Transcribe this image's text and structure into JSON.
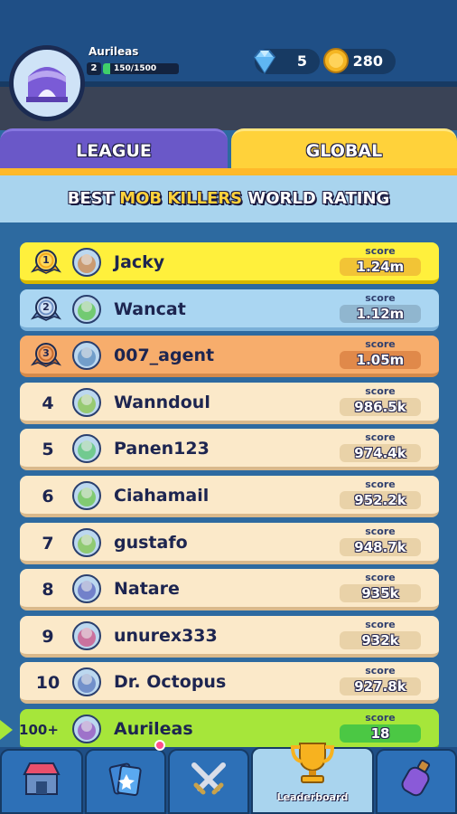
{
  "player": {
    "name": "Aurileas",
    "level": "2",
    "xp_text": "150/1500",
    "xp_fraction": 0.1
  },
  "currency": {
    "gems": "5",
    "coins": "280"
  },
  "tabs": [
    {
      "label": "LEAGUE",
      "active": false
    },
    {
      "label": "GLOBAL",
      "active": true
    }
  ],
  "banner": {
    "part1": "BEST ",
    "highlight": "MOB KILLERS",
    "part2": " WORLD RATING"
  },
  "score_label": "score",
  "rows": [
    {
      "rank": "1",
      "name": "Jacky",
      "score": "1.24m",
      "style": "gold",
      "medal": true
    },
    {
      "rank": "2",
      "name": "Wancat",
      "score": "1.12m",
      "style": "silver",
      "medal": true
    },
    {
      "rank": "3",
      "name": "007_agent",
      "score": "1.05m",
      "style": "bronze",
      "medal": true
    },
    {
      "rank": "4",
      "name": "Wanndoul",
      "score": "986.5k",
      "style": "plain",
      "medal": false
    },
    {
      "rank": "5",
      "name": "Panen123",
      "score": "974.4k",
      "style": "plain",
      "medal": false
    },
    {
      "rank": "6",
      "name": "Ciahamail",
      "score": "952.2k",
      "style": "plain",
      "medal": false
    },
    {
      "rank": "7",
      "name": "gustafo",
      "score": "948.7k",
      "style": "plain",
      "medal": false
    },
    {
      "rank": "8",
      "name": "Natare",
      "score": "935k",
      "style": "plain",
      "medal": false
    },
    {
      "rank": "9",
      "name": "unurex333",
      "score": "932k",
      "style": "plain",
      "medal": false
    },
    {
      "rank": "10",
      "name": "Dr. Octopus",
      "score": "927.8k",
      "style": "plain",
      "medal": false
    },
    {
      "rank": "100+",
      "name": "Aurileas",
      "score": "18",
      "style": "me",
      "medal": false
    }
  ],
  "nav": [
    {
      "icon": "shop-icon",
      "label": ""
    },
    {
      "icon": "cards-icon",
      "label": ""
    },
    {
      "icon": "battle-swords-icon",
      "label": ""
    },
    {
      "icon": "trophy-icon",
      "label": "Leaderboard",
      "active": true
    },
    {
      "icon": "potion-icon",
      "label": ""
    }
  ],
  "colors": {
    "gold_row": "#fff03c",
    "silver_row": "#aad6f2",
    "bronze_row": "#f7ad6c",
    "player_row": "#a6e63a",
    "tab_active": "#ffd23a",
    "tab_inactive": "#6a58c8"
  }
}
